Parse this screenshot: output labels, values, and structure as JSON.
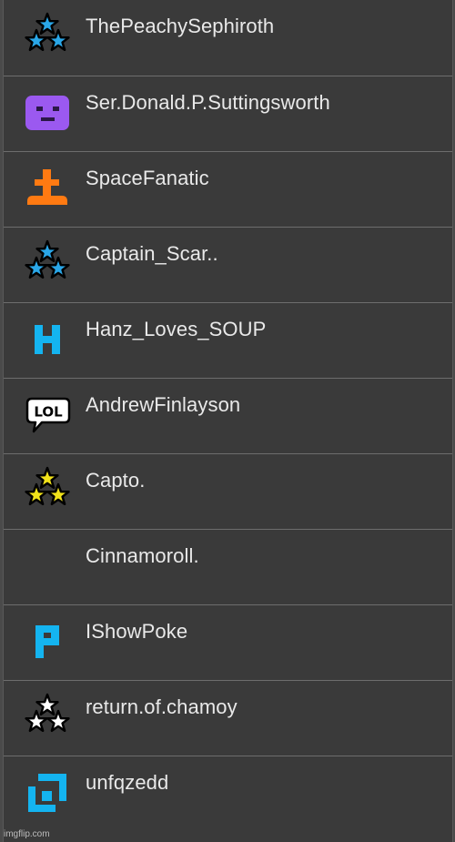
{
  "users": [
    {
      "name": "ThePeachySephiroth",
      "icon": "blue-stars-rank-icon",
      "color": "#2aa7e8"
    },
    {
      "name": "Ser.Donald.P.Suttingsworth",
      "icon": "purple-square-face-icon",
      "color": "#9b59f0"
    },
    {
      "name": "SpaceFanatic",
      "icon": "orange-plunger-icon",
      "color": "#ff7a12"
    },
    {
      "name": "Captain_Scar..",
      "icon": "blue-stars-rank-icon",
      "color": "#2aa7e8"
    },
    {
      "name": "Hanz_Loves_SOUP",
      "icon": "blue-h-letter-icon",
      "color": "#14b4f0"
    },
    {
      "name": "AndrewFinlayson",
      "icon": "lol-speech-bubble-icon",
      "color": "#ffffff"
    },
    {
      "name": "Capto.",
      "icon": "yellow-stars-rank-icon",
      "color": "#f1e21a"
    },
    {
      "name": "Cinnamoroll.",
      "icon": "",
      "color": ""
    },
    {
      "name": "IShowPoke",
      "icon": "blue-p-letter-icon",
      "color": "#14b4f0"
    },
    {
      "name": "return.of.chamoy",
      "icon": "white-stars-rank-icon",
      "color": "#ffffff"
    },
    {
      "name": "unfqzedd",
      "icon": "blue-square-logo-icon",
      "color": "#14b4f0"
    }
  ],
  "watermark": "imgflip.com"
}
